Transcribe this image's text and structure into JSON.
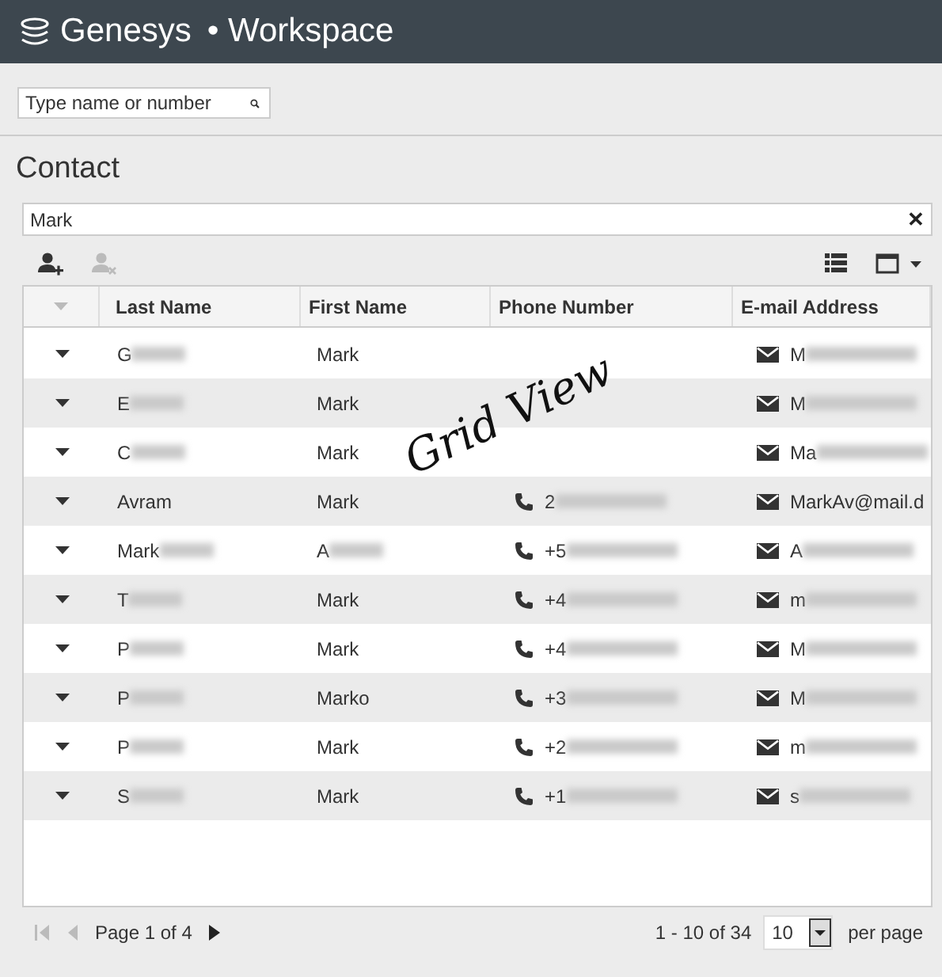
{
  "header": {
    "brand": "Genesys",
    "product": "• Workspace"
  },
  "quick_search": {
    "placeholder": "Type name or number"
  },
  "section_title": "Contact",
  "contact_search": {
    "value": "Mark",
    "clear": "✕"
  },
  "toolbar": {
    "add_enabled": true,
    "remove_enabled": false
  },
  "table": {
    "columns": [
      "Last Name",
      "First Name",
      "Phone Number",
      "E-mail Address"
    ],
    "rows": [
      {
        "last": {
          "text": "G",
          "blurred": true
        },
        "first": {
          "text": "Mark",
          "blurred": false
        },
        "phone": null,
        "email": {
          "text": "M",
          "blurred": true
        }
      },
      {
        "last": {
          "text": "E",
          "blurred": true
        },
        "first": {
          "text": "Mark",
          "blurred": false
        },
        "phone": null,
        "email": {
          "text": "M",
          "blurred": true
        }
      },
      {
        "last": {
          "text": "C",
          "blurred": true
        },
        "first": {
          "text": "Mark",
          "blurred": false
        },
        "phone": null,
        "email": {
          "text": "Ma",
          "blurred": true
        }
      },
      {
        "last": {
          "text": "Avram",
          "blurred": false
        },
        "first": {
          "text": "Mark",
          "blurred": false
        },
        "phone": {
          "text": "2",
          "blurred": true
        },
        "email": {
          "text": "MarkAv@mail.d",
          "blurred": false
        }
      },
      {
        "last": {
          "text": "Mark",
          "blurred": true
        },
        "first": {
          "text": "A",
          "blurred": true
        },
        "phone": {
          "text": "+5",
          "blurred": true
        },
        "email": {
          "text": "A",
          "blurred": true
        }
      },
      {
        "last": {
          "text": "T",
          "blurred": true
        },
        "first": {
          "text": "Mark",
          "blurred": false
        },
        "phone": {
          "text": "+4",
          "blurred": true
        },
        "email": {
          "text": "m",
          "blurred": true
        }
      },
      {
        "last": {
          "text": "P",
          "blurred": true
        },
        "first": {
          "text": "Mark",
          "blurred": false
        },
        "phone": {
          "text": "+4",
          "blurred": true
        },
        "email": {
          "text": "M",
          "blurred": true
        }
      },
      {
        "last": {
          "text": "P",
          "blurred": true
        },
        "first": {
          "text": "Marko",
          "blurred": false
        },
        "phone": {
          "text": "+3",
          "blurred": true
        },
        "email": {
          "text": "M",
          "blurred": true
        }
      },
      {
        "last": {
          "text": "P",
          "blurred": true
        },
        "first": {
          "text": "Mark",
          "blurred": false
        },
        "phone": {
          "text": "+2",
          "blurred": true
        },
        "email": {
          "text": "m",
          "blurred": true
        }
      },
      {
        "last": {
          "text": "S",
          "blurred": true
        },
        "first": {
          "text": "Mark",
          "blurred": false
        },
        "phone": {
          "text": "+1",
          "blurred": true
        },
        "email": {
          "text": "s",
          "blurred": true
        }
      }
    ]
  },
  "pagination": {
    "page_label": "Page 1 of 4",
    "range": "1 - 10 of 34",
    "page_size": "10",
    "per_page": "per page"
  },
  "annotation": "Grid View"
}
